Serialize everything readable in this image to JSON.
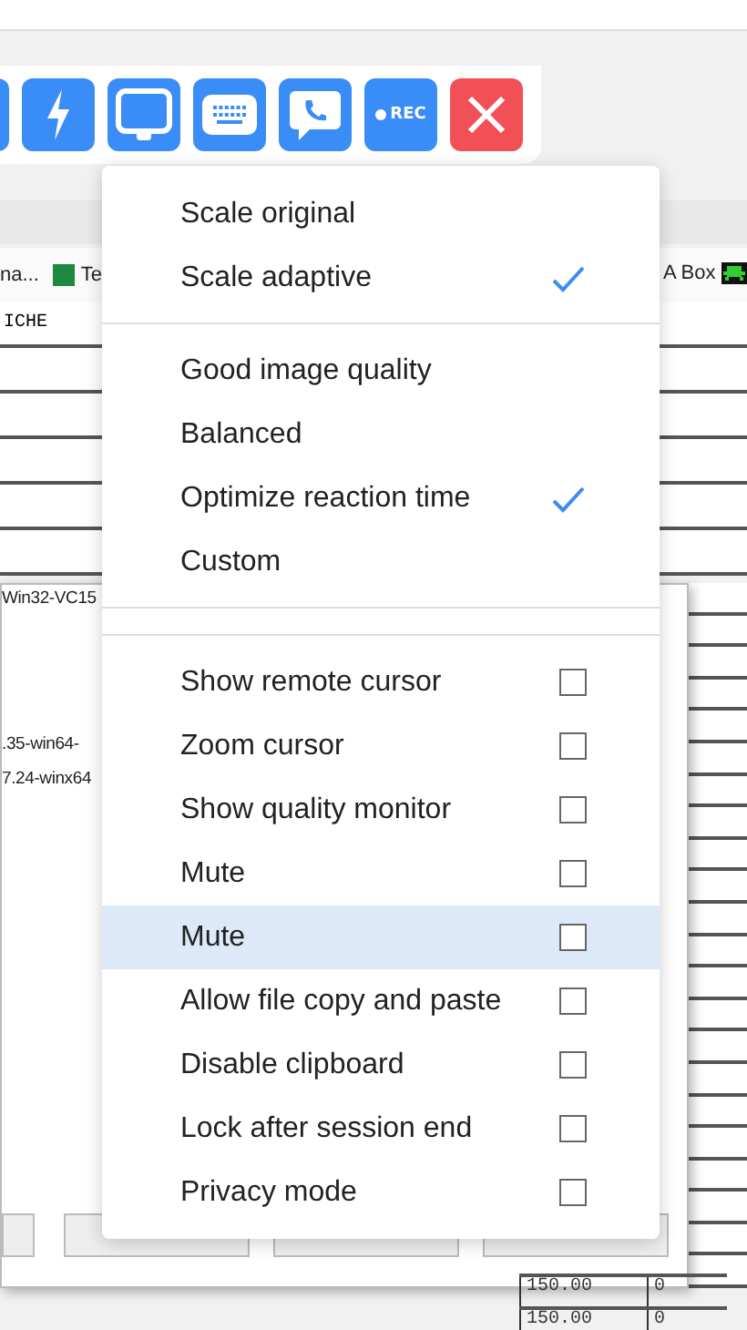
{
  "remote_screen": {
    "tabs": [
      {
        "label": "na...",
        "kind": "text"
      },
      {
        "label": "Te",
        "kind": "app"
      },
      {
        "label": "A Box",
        "kind": "text"
      }
    ],
    "table_cell": "ICHE",
    "dialog_lines": [
      "Win32-VC15",
      ".35-win64-",
      "7.24-winx64"
    ],
    "bottom_rows": [
      {
        "value": "150.00",
        "count": "0"
      },
      {
        "value": "150.00",
        "count": "0"
      }
    ]
  },
  "toolbar": {
    "buttons": [
      {
        "kind": "partial"
      },
      {
        "kind": "lightning"
      },
      {
        "kind": "display"
      },
      {
        "kind": "keyboard"
      },
      {
        "kind": "chat"
      },
      {
        "kind": "record",
        "label": "REC"
      },
      {
        "kind": "close"
      }
    ]
  },
  "menu": {
    "sections": [
      {
        "items": [
          {
            "label": "Scale original",
            "kind": "choice",
            "selected": false
          },
          {
            "label": "Scale adaptive",
            "kind": "choice",
            "selected": true
          }
        ]
      },
      {
        "items": [
          {
            "label": "Good image quality",
            "kind": "choice",
            "selected": false
          },
          {
            "label": "Balanced",
            "kind": "choice",
            "selected": false
          },
          {
            "label": "Optimize reaction time",
            "kind": "choice",
            "selected": true
          },
          {
            "label": "Custom",
            "kind": "choice",
            "selected": false
          }
        ]
      },
      {
        "items": [
          {
            "label": "Show remote cursor",
            "kind": "toggle",
            "checked": false,
            "highlighted": false
          },
          {
            "label": "Zoom cursor",
            "kind": "toggle",
            "checked": false,
            "highlighted": false
          },
          {
            "label": "Show quality monitor",
            "kind": "toggle",
            "checked": false,
            "highlighted": false
          },
          {
            "label": "Mute",
            "kind": "toggle",
            "checked": false,
            "highlighted": false
          },
          {
            "label": "Mute",
            "kind": "toggle",
            "checked": false,
            "highlighted": true
          },
          {
            "label": "Allow file copy and paste",
            "kind": "toggle",
            "checked": false,
            "highlighted": false
          },
          {
            "label": "Disable clipboard",
            "kind": "toggle",
            "checked": false,
            "highlighted": false
          },
          {
            "label": "Lock after session end",
            "kind": "toggle",
            "checked": false,
            "highlighted": false
          },
          {
            "label": "Privacy mode",
            "kind": "toggle",
            "checked": false,
            "highlighted": false
          }
        ]
      }
    ]
  }
}
